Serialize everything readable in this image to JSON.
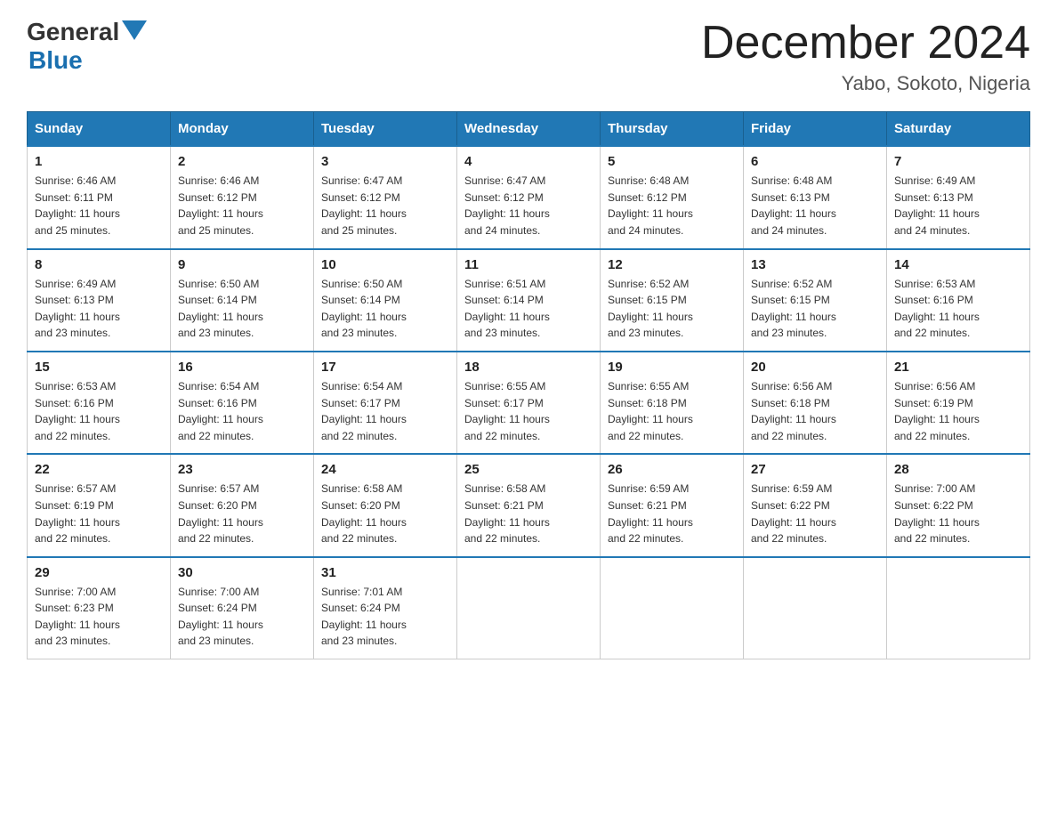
{
  "header": {
    "logo": {
      "general": "General",
      "blue": "Blue",
      "triangle_alt": "triangle icon"
    },
    "title": "December 2024",
    "subtitle": "Yabo, Sokoto, Nigeria"
  },
  "days_of_week": [
    "Sunday",
    "Monday",
    "Tuesday",
    "Wednesday",
    "Thursday",
    "Friday",
    "Saturday"
  ],
  "weeks": [
    [
      {
        "day": "1",
        "sunrise": "6:46 AM",
        "sunset": "6:11 PM",
        "daylight": "11 hours and 25 minutes."
      },
      {
        "day": "2",
        "sunrise": "6:46 AM",
        "sunset": "6:12 PM",
        "daylight": "11 hours and 25 minutes."
      },
      {
        "day": "3",
        "sunrise": "6:47 AM",
        "sunset": "6:12 PM",
        "daylight": "11 hours and 25 minutes."
      },
      {
        "day": "4",
        "sunrise": "6:47 AM",
        "sunset": "6:12 PM",
        "daylight": "11 hours and 24 minutes."
      },
      {
        "day": "5",
        "sunrise": "6:48 AM",
        "sunset": "6:12 PM",
        "daylight": "11 hours and 24 minutes."
      },
      {
        "day": "6",
        "sunrise": "6:48 AM",
        "sunset": "6:13 PM",
        "daylight": "11 hours and 24 minutes."
      },
      {
        "day": "7",
        "sunrise": "6:49 AM",
        "sunset": "6:13 PM",
        "daylight": "11 hours and 24 minutes."
      }
    ],
    [
      {
        "day": "8",
        "sunrise": "6:49 AM",
        "sunset": "6:13 PM",
        "daylight": "11 hours and 23 minutes."
      },
      {
        "day": "9",
        "sunrise": "6:50 AM",
        "sunset": "6:14 PM",
        "daylight": "11 hours and 23 minutes."
      },
      {
        "day": "10",
        "sunrise": "6:50 AM",
        "sunset": "6:14 PM",
        "daylight": "11 hours and 23 minutes."
      },
      {
        "day": "11",
        "sunrise": "6:51 AM",
        "sunset": "6:14 PM",
        "daylight": "11 hours and 23 minutes."
      },
      {
        "day": "12",
        "sunrise": "6:52 AM",
        "sunset": "6:15 PM",
        "daylight": "11 hours and 23 minutes."
      },
      {
        "day": "13",
        "sunrise": "6:52 AM",
        "sunset": "6:15 PM",
        "daylight": "11 hours and 23 minutes."
      },
      {
        "day": "14",
        "sunrise": "6:53 AM",
        "sunset": "6:16 PM",
        "daylight": "11 hours and 22 minutes."
      }
    ],
    [
      {
        "day": "15",
        "sunrise": "6:53 AM",
        "sunset": "6:16 PM",
        "daylight": "11 hours and 22 minutes."
      },
      {
        "day": "16",
        "sunrise": "6:54 AM",
        "sunset": "6:16 PM",
        "daylight": "11 hours and 22 minutes."
      },
      {
        "day": "17",
        "sunrise": "6:54 AM",
        "sunset": "6:17 PM",
        "daylight": "11 hours and 22 minutes."
      },
      {
        "day": "18",
        "sunrise": "6:55 AM",
        "sunset": "6:17 PM",
        "daylight": "11 hours and 22 minutes."
      },
      {
        "day": "19",
        "sunrise": "6:55 AM",
        "sunset": "6:18 PM",
        "daylight": "11 hours and 22 minutes."
      },
      {
        "day": "20",
        "sunrise": "6:56 AM",
        "sunset": "6:18 PM",
        "daylight": "11 hours and 22 minutes."
      },
      {
        "day": "21",
        "sunrise": "6:56 AM",
        "sunset": "6:19 PM",
        "daylight": "11 hours and 22 minutes."
      }
    ],
    [
      {
        "day": "22",
        "sunrise": "6:57 AM",
        "sunset": "6:19 PM",
        "daylight": "11 hours and 22 minutes."
      },
      {
        "day": "23",
        "sunrise": "6:57 AM",
        "sunset": "6:20 PM",
        "daylight": "11 hours and 22 minutes."
      },
      {
        "day": "24",
        "sunrise": "6:58 AM",
        "sunset": "6:20 PM",
        "daylight": "11 hours and 22 minutes."
      },
      {
        "day": "25",
        "sunrise": "6:58 AM",
        "sunset": "6:21 PM",
        "daylight": "11 hours and 22 minutes."
      },
      {
        "day": "26",
        "sunrise": "6:59 AM",
        "sunset": "6:21 PM",
        "daylight": "11 hours and 22 minutes."
      },
      {
        "day": "27",
        "sunrise": "6:59 AM",
        "sunset": "6:22 PM",
        "daylight": "11 hours and 22 minutes."
      },
      {
        "day": "28",
        "sunrise": "7:00 AM",
        "sunset": "6:22 PM",
        "daylight": "11 hours and 22 minutes."
      }
    ],
    [
      {
        "day": "29",
        "sunrise": "7:00 AM",
        "sunset": "6:23 PM",
        "daylight": "11 hours and 23 minutes."
      },
      {
        "day": "30",
        "sunrise": "7:00 AM",
        "sunset": "6:24 PM",
        "daylight": "11 hours and 23 minutes."
      },
      {
        "day": "31",
        "sunrise": "7:01 AM",
        "sunset": "6:24 PM",
        "daylight": "11 hours and 23 minutes."
      },
      null,
      null,
      null,
      null
    ]
  ],
  "labels": {
    "sunrise": "Sunrise:",
    "sunset": "Sunset:",
    "daylight": "Daylight:"
  }
}
